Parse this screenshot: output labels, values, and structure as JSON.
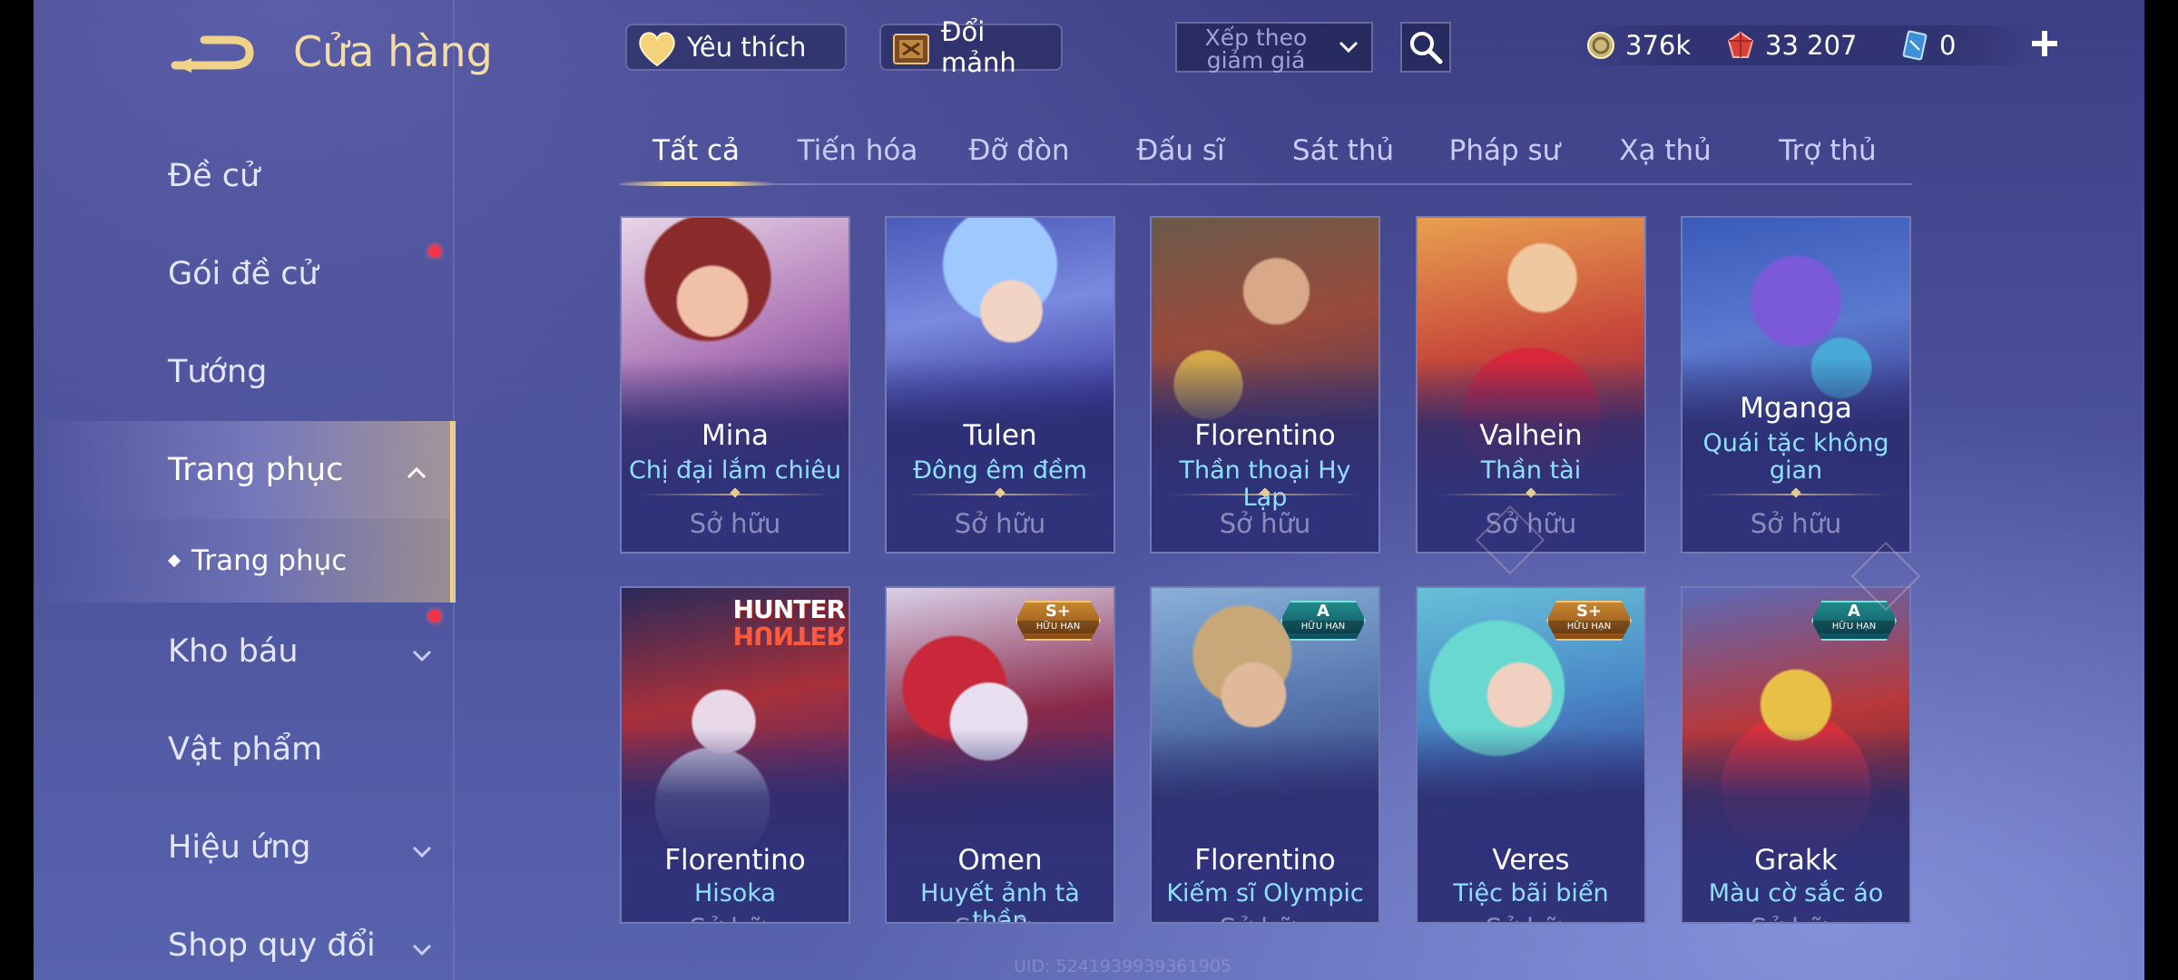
{
  "header": {
    "title": "Cửa hàng",
    "favorites_label": "Yêu thích",
    "exchange_label": "Đổi mảnh",
    "sort": {
      "selected": "Xếp theo giảm giá"
    },
    "currencies": [
      {
        "name": "gold",
        "value": "376k",
        "color": "#e8d08a"
      },
      {
        "name": "voucher",
        "value": "33 207",
        "color": "#e0443a"
      },
      {
        "name": "diamond",
        "value": "0",
        "color": "#6ac7ff"
      }
    ]
  },
  "sidebar": {
    "items": [
      {
        "label": "Đề cử"
      },
      {
        "label": "Gói đề cử"
      },
      {
        "label": "Tướng"
      },
      {
        "label": "Trang phục"
      },
      {
        "label": "Kho báu"
      },
      {
        "label": "Vật phẩm"
      },
      {
        "label": "Hiệu ứng"
      },
      {
        "label": "Shop quy đổi"
      }
    ],
    "sub_item": "Trang phục"
  },
  "tabs": [
    "Tất cả",
    "Tiến hóa",
    "Đỡ đòn",
    "Đấu sĩ",
    "Sát thủ",
    "Pháp sư",
    "Xạ thủ",
    "Trợ thủ"
  ],
  "cards": [
    {
      "hero": "Mina",
      "skin": "Chị đại lắm chiêu",
      "status": "Sở hữu"
    },
    {
      "hero": "Tulen",
      "skin": "Đông êm đềm",
      "status": "Sở hữu"
    },
    {
      "hero": "Florentino",
      "skin": "Thần thoại Hy Lạp",
      "status": "Sở hữu"
    },
    {
      "hero": "Valhein",
      "skin": "Thần tài",
      "status": "Sở hữu"
    },
    {
      "hero": "Mganga",
      "skin": "Quái tặc không gian",
      "status": "Sở hữu"
    },
    {
      "hero": "Florentino",
      "skin": "Hisoka",
      "status": "Sở hữu",
      "logo": [
        "HUNTER",
        "HUNTER"
      ]
    },
    {
      "hero": "Omen",
      "skin": "Huyết ảnh tà thần",
      "status": "Sở hữu",
      "tier": "S+",
      "tier_sub": "HỮU HẠN"
    },
    {
      "hero": "Florentino",
      "skin": "Kiếm sĩ Olympic",
      "status": "Sở hữu",
      "tier": "A",
      "tier_sub": "HỮU HẠN"
    },
    {
      "hero": "Veres",
      "skin": "Tiệc bãi biển",
      "status": "Sở hữu",
      "tier": "S+",
      "tier_sub": "HỮU HẠN"
    },
    {
      "hero": "Grakk",
      "skin": "Màu cờ sắc áo",
      "status": "Sở hữu",
      "tier": "A",
      "tier_sub": "HỮU HẠN"
    }
  ],
  "footer": {
    "uid": "UID: 5241939939361905"
  },
  "accent_color": "#f1d28a",
  "notification_color": "#f0344a"
}
